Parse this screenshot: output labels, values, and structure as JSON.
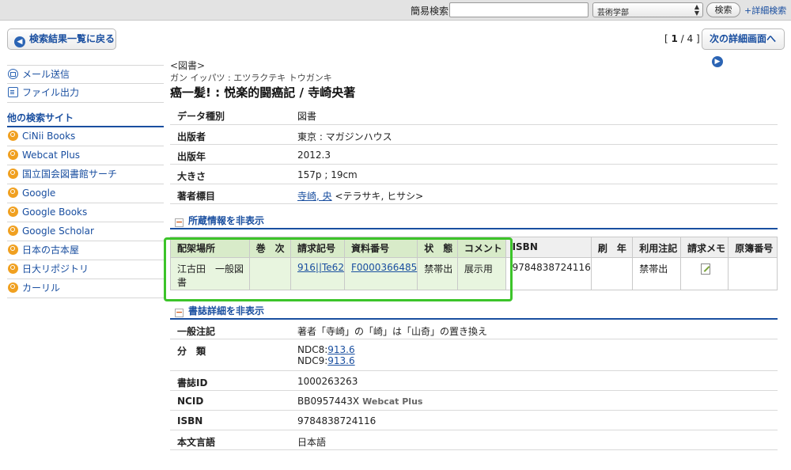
{
  "topbar": {
    "search_label": "簡易検索:",
    "search_value": "",
    "scope_selected": "芸術学部",
    "search_button": "検索",
    "advanced_link": "+詳細検索"
  },
  "nav": {
    "back_label": "検索結果一覧に戻る",
    "pager_open": "[ ",
    "pager_current": "1",
    "pager_rest": " / 4 ]",
    "next_label": "次の詳細画面へ"
  },
  "sidebar": {
    "actions": [
      {
        "label": "メール送信",
        "icon": "mail-icon"
      },
      {
        "label": "ファイル出力",
        "icon": "file-icon"
      }
    ],
    "other_sites_heading": "他の検索サイト",
    "sites": [
      {
        "label": "CiNii Books"
      },
      {
        "label": "Webcat Plus"
      },
      {
        "label": "国立国会図書館サーチ"
      },
      {
        "label": "Google"
      },
      {
        "label": "Google Books"
      },
      {
        "label": "Google Scholar"
      },
      {
        "label": "日本の古本屋"
      },
      {
        "label": "日大リポジトリ"
      },
      {
        "label": "カーリル"
      }
    ]
  },
  "record": {
    "material_tag": "<図書>",
    "title_reading": "ガン イッパツ : エツラクテキ トウガンキ",
    "title": "癌一髪! : 悦楽的闘癌記 / 寺崎央著",
    "fields": [
      {
        "key": "データ種別",
        "value": "図書"
      },
      {
        "key": "出版者",
        "value": "東京 : マガジンハウス"
      },
      {
        "key": "出版年",
        "value": "2012.3"
      },
      {
        "key": "大きさ",
        "value": "157p ; 19cm"
      }
    ],
    "author_key": "著者標目",
    "author_link": "寺崎, 央",
    "author_reading": " <テラサキ, ヒサシ>"
  },
  "holdings": {
    "toggle_label": "所蔵情報を非表示",
    "columns": [
      "配架場所",
      "巻　次",
      "請求記号",
      "資料番号",
      "状　態",
      "コメント",
      "ISBN",
      "刷　年",
      "利用注記",
      "請求メモ",
      "原簿番号"
    ],
    "row": {
      "location": "江古田　一般図書",
      "volume": "",
      "call_number": "916||Te62",
      "item_number": "F0000366485",
      "status": "禁帯出",
      "comment": "展示用",
      "isbn": "9784838724116",
      "printing_year": "",
      "usage_note": "禁帯出",
      "request_memo_icon": "memo-edit-icon",
      "ledger_number": ""
    }
  },
  "bib_details": {
    "toggle_label": "書誌詳細を非表示",
    "general_note_key": "一般注記",
    "general_note": "著者「寺崎」の「崎」は「山奇」の置き換え",
    "classification_key": "分　類",
    "ndc8_prefix": "NDC8:",
    "ndc8_link": "913.6",
    "ndc9_prefix": "NDC9:",
    "ndc9_link": "913.6",
    "bibid_key": "書誌ID",
    "bibid": "1000263263",
    "ncid_key": "NCID",
    "ncid": "BB0957443X",
    "ncid_link": "Webcat Plus",
    "isbn_key": "ISBN",
    "isbn": "9784838724116",
    "language_key": "本文言語",
    "language": "日本語"
  },
  "colors": {
    "link": "#1a4fa0",
    "highlight_border": "#3cc42a",
    "highlight_fill": "#e8f5df",
    "section_toggle": "#d25a18"
  }
}
